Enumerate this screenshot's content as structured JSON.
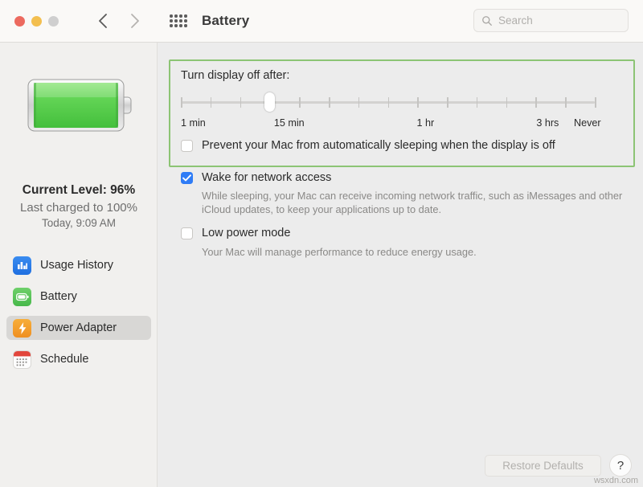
{
  "window": {
    "title": "Battery",
    "traffic_lights": [
      "close",
      "minimize",
      "zoom"
    ],
    "back_icon": "chevron-left-icon",
    "forward_icon": "chevron-right-icon",
    "grid_icon": "grid-apps-icon"
  },
  "search": {
    "placeholder": "Search",
    "value": "",
    "icon": "search-icon"
  },
  "sidebar": {
    "battery_icon": "battery-full-icon",
    "current_level": "Current Level: 96%",
    "last_charged": "Last charged to 100%",
    "charge_time": "Today, 9:09 AM",
    "items": [
      {
        "label": "Usage History",
        "icon": "bar-chart-icon",
        "selected": false
      },
      {
        "label": "Battery",
        "icon": "battery-icon",
        "selected": false
      },
      {
        "label": "Power Adapter",
        "icon": "bolt-icon",
        "selected": true
      },
      {
        "label": "Schedule",
        "icon": "calendar-icon",
        "selected": false
      }
    ]
  },
  "main": {
    "display_off_label": "Turn display off after:",
    "slider": {
      "tick_count": 15,
      "value_index": 3,
      "labels": [
        {
          "text": "1 min",
          "pos_pct": 0
        },
        {
          "text": "15 min",
          "pos_pct": 22.5
        },
        {
          "text": "1 hr",
          "pos_pct": 57
        },
        {
          "text": "3 hrs",
          "pos_pct": 89
        },
        {
          "text": "Never",
          "pos_pct": 100
        }
      ]
    },
    "options": [
      {
        "label": "Prevent your Mac from automatically sleeping when the display is off",
        "checked": false,
        "description": ""
      },
      {
        "label": "Wake for network access",
        "checked": true,
        "description": "While sleeping, your Mac can receive incoming network traffic, such as iMessages and other iCloud updates, to keep your applications up to date."
      },
      {
        "label": "Low power mode",
        "checked": false,
        "description": "Your Mac will manage performance to reduce energy usage."
      }
    ],
    "restore_defaults_label": "Restore Defaults",
    "help_label": "?"
  },
  "watermark": "wsxdn.com",
  "colors": {
    "accent_blue": "#2f7cf6",
    "highlight_green": "#8cc474",
    "battery_green": "#5ecb4f",
    "selected_row": "#d8d7d5"
  }
}
